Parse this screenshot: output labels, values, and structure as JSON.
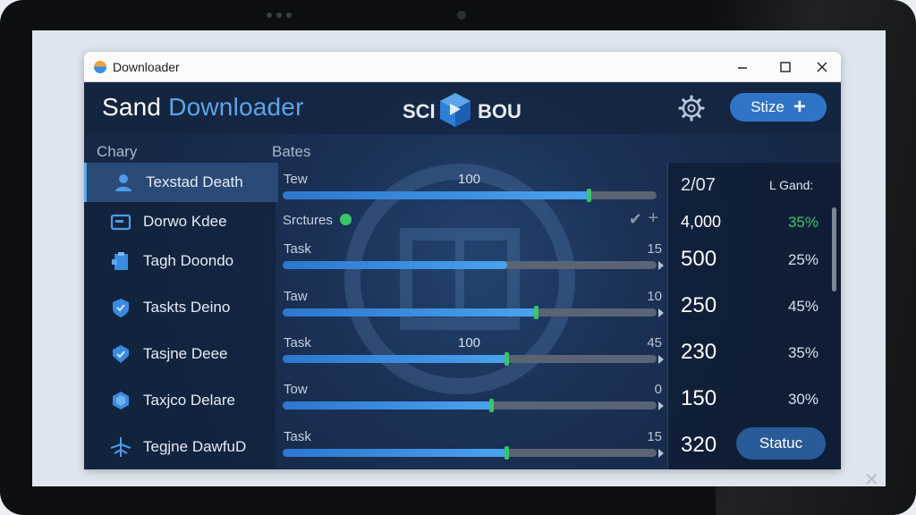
{
  "window": {
    "title": "Downloader",
    "minimize": "—",
    "maximize": "☐",
    "close": "✕"
  },
  "header": {
    "brand_first": "Sand",
    "brand_second": "Downloader",
    "logo_left": "SCI",
    "logo_right": "BOU",
    "size_button": "Stize",
    "size_plus": "+"
  },
  "columns": {
    "left": "Chary",
    "middle": "Bates"
  },
  "sidebar": {
    "items": [
      {
        "label": "Texstad Death",
        "icon": "user-icon",
        "active": true
      },
      {
        "label": "Dorwo Kdee",
        "icon": "folder-icon",
        "active": false
      },
      {
        "label": "Tagh Doondo",
        "icon": "clipboard-icon",
        "active": false
      },
      {
        "label": "Taskts Deino",
        "icon": "shield-check-icon",
        "active": false
      },
      {
        "label": "Tasjne Deee",
        "icon": "shield-check-icon",
        "active": false
      },
      {
        "label": "Taxjco Delare",
        "icon": "cube-icon",
        "active": false
      },
      {
        "label": "Tegjne DawfuD",
        "icon": "network-icon",
        "active": false
      }
    ]
  },
  "tasks": {
    "status_label": "Srctures",
    "rows": [
      {
        "label": "Tew",
        "value": "100",
        "max": "",
        "progress": 0.82
      },
      {
        "label": "Task",
        "value": "",
        "max": "15",
        "progress": 0.6
      },
      {
        "label": "Taw",
        "value": "",
        "max": "10",
        "progress": 0.68
      },
      {
        "label": "Task",
        "value": "100",
        "max": "45",
        "progress": 0.6
      },
      {
        "label": "Tow",
        "value": "",
        "max": "0",
        "progress": 0.56
      },
      {
        "label": "Task",
        "value": "",
        "max": "15",
        "progress": 0.6
      }
    ]
  },
  "right_panel": {
    "header_num": "2/07",
    "header_label": "L Gand:",
    "rows": [
      {
        "num": "4,000",
        "pct": "35%",
        "highlight": true
      },
      {
        "num": "500",
        "pct": "25%",
        "highlight": false
      },
      {
        "num": "250",
        "pct": "45%",
        "highlight": false
      },
      {
        "num": "230",
        "pct": "35%",
        "highlight": false
      },
      {
        "num": "150",
        "pct": "30%",
        "highlight": false
      },
      {
        "num": "320",
        "pct": "",
        "highlight": false
      }
    ],
    "status_button": "Statuc"
  },
  "colors": {
    "accent": "#5aa6ea",
    "progress_knob": "#39c56a",
    "highlight_pct": "#39c56a"
  }
}
